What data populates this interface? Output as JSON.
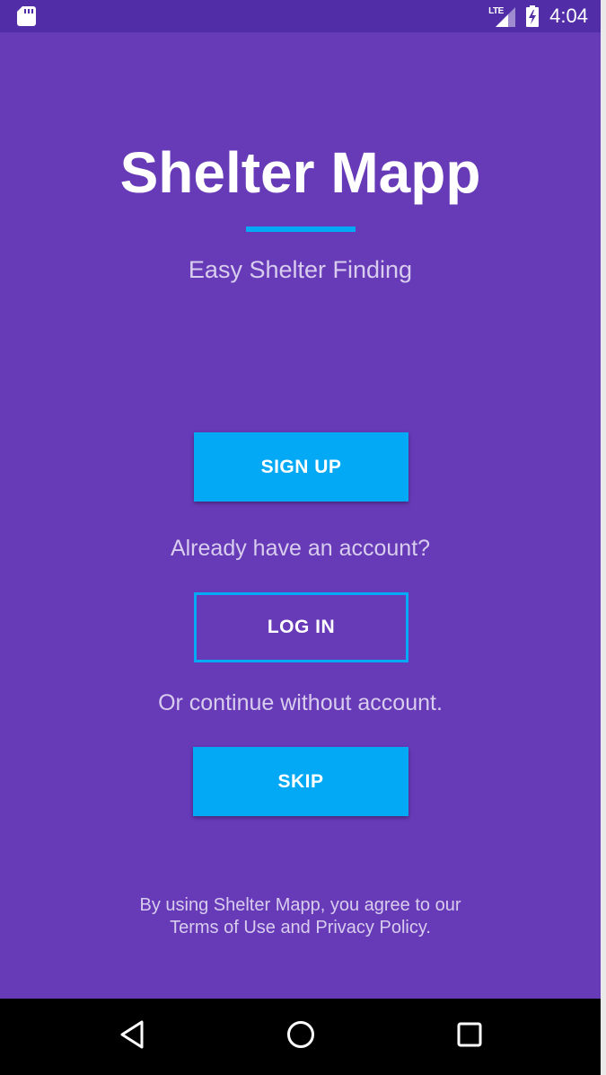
{
  "status_bar": {
    "network_label": "LTE",
    "time": "4:04",
    "icons": [
      "sd-card-icon",
      "lte-signal-icon",
      "battery-charging-icon"
    ]
  },
  "app": {
    "title": "Shelter Mapp",
    "subtitle": "Easy Shelter Finding",
    "signup_label": "SIGN UP",
    "account_prompt": "Already have an account?",
    "login_label": "LOG IN",
    "skip_prompt": "Or continue without account.",
    "skip_label": "SKIP",
    "legal_line1": "By using Shelter Mapp, you agree to our",
    "legal_line2": "Terms of Use and Privacy Policy."
  },
  "nav_bar": {
    "icons": [
      "back-icon",
      "home-icon",
      "recents-icon"
    ]
  },
  "colors": {
    "background": "#673ab7",
    "status_bar": "#512da8",
    "accent": "#03a9f4",
    "muted_text": "#d8cdee"
  }
}
